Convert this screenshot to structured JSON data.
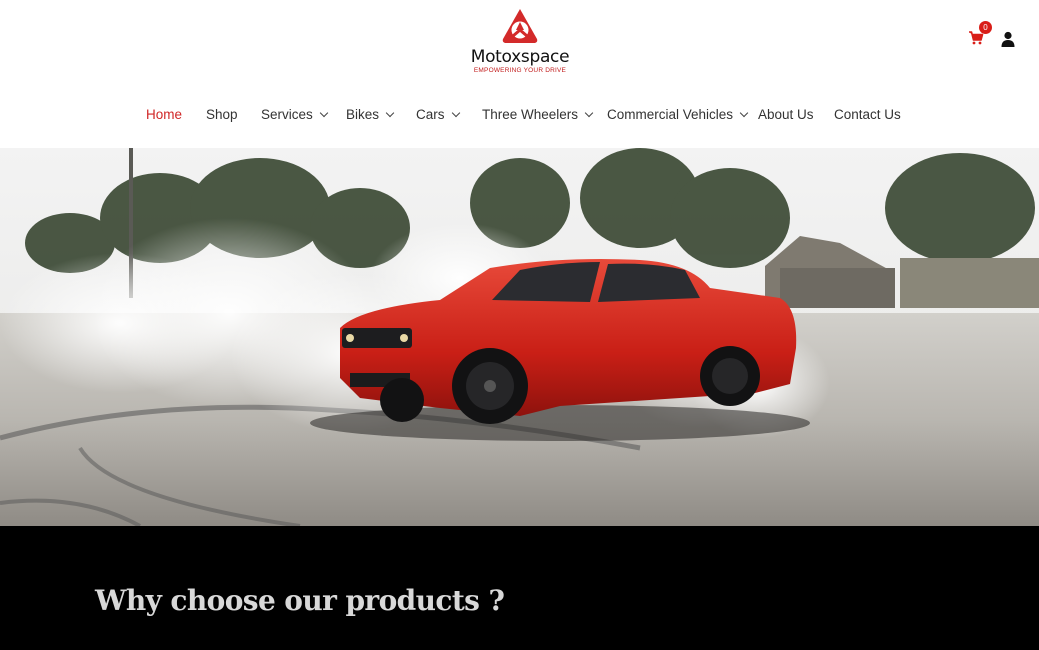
{
  "brand": {
    "name": "Motoxspace",
    "tagline": "EMPOWERING YOUR DRIVE",
    "logo_color": "#d32a2a"
  },
  "header_actions": {
    "cart_count": "0",
    "cart_icon": "cart-icon",
    "account_icon": "user-icon"
  },
  "nav": {
    "items": [
      {
        "label": "Home",
        "active": true,
        "dropdown": false
      },
      {
        "label": "Shop",
        "dropdown": false
      },
      {
        "label": "Services",
        "dropdown": true
      },
      {
        "label": "Bikes",
        "dropdown": true
      },
      {
        "label": "Cars",
        "dropdown": true
      },
      {
        "label": "Three Wheelers",
        "dropdown": true
      },
      {
        "label": "Commercial Vehicles",
        "dropdown": true
      },
      {
        "label": "About Us",
        "dropdown": false
      },
      {
        "label": "Contact Us",
        "dropdown": false
      }
    ]
  },
  "section": {
    "title": "Why choose our products ?"
  },
  "colors": {
    "accent": "#d02727",
    "nav_text": "#333333",
    "section_bg": "#000000",
    "section_title": "#d8d8d8"
  }
}
